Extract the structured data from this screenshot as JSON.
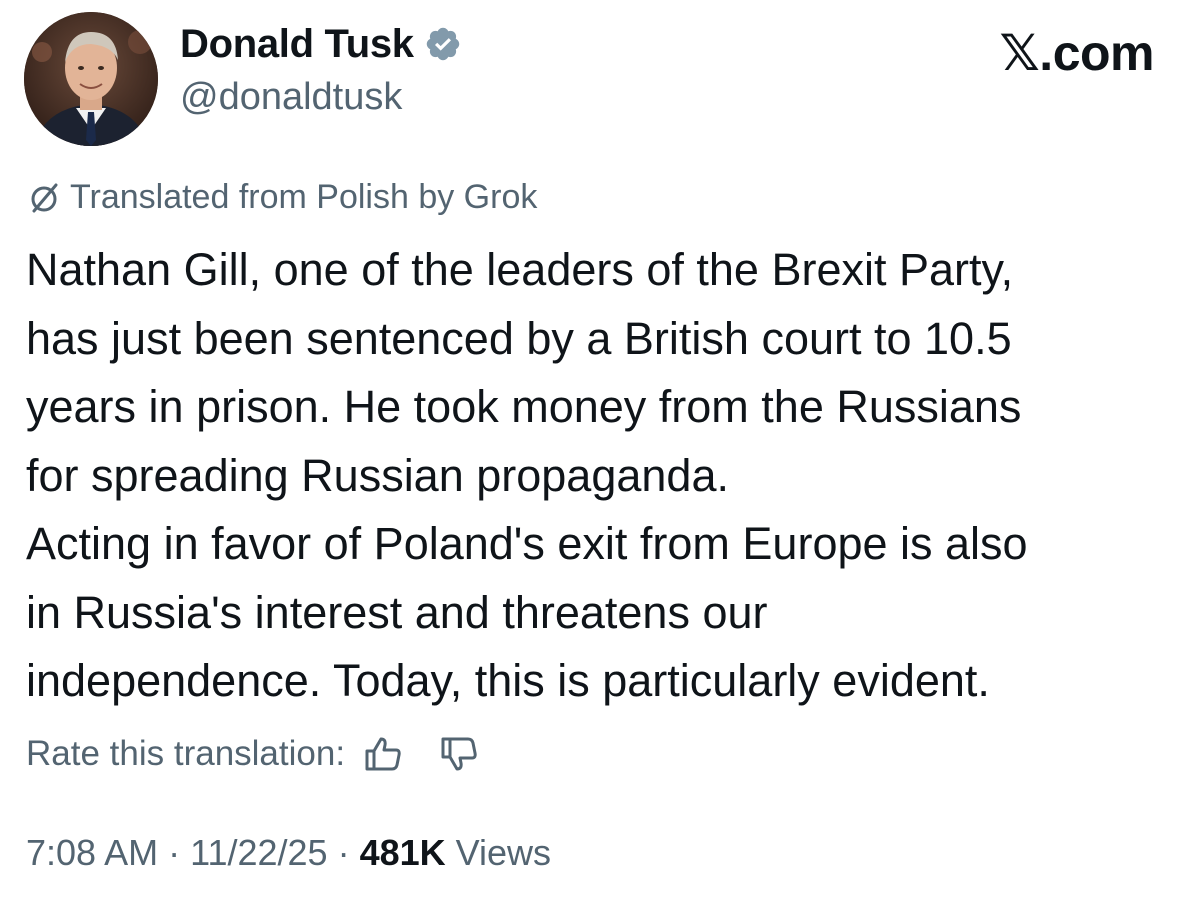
{
  "author": {
    "display_name": "Donald Tusk",
    "handle": "@donaldtusk",
    "verified_icon": "verified-badge-icon",
    "avatar": "profile-photo"
  },
  "watermark": "𝕏.com",
  "translation": {
    "notice": "Translated from Polish by Grok",
    "icon": "grok-icon"
  },
  "post": {
    "lines": [
      "Nathan Gill, one of the leaders of the Brexit Party,",
      "has just been sentenced by a British court to 10.5",
      "years in prison. He took money from the Russians",
      "for spreading Russian propaganda.",
      "Acting in favor of Poland's exit from Europe is also",
      "in Russia's interest and threatens our",
      "independence. Today, this is particularly evident."
    ]
  },
  "rate": {
    "label": "Rate this translation:",
    "up_icon": "thumbs-up-icon",
    "down_icon": "thumbs-down-icon"
  },
  "meta": {
    "time": "7:08 AM",
    "separator": " · ",
    "date": "11/22/25",
    "views_count": "481K",
    "views_label": "Views"
  },
  "colors": {
    "text_primary": "#0f1419",
    "text_secondary": "#536471",
    "verified_badge": "#829aab"
  }
}
